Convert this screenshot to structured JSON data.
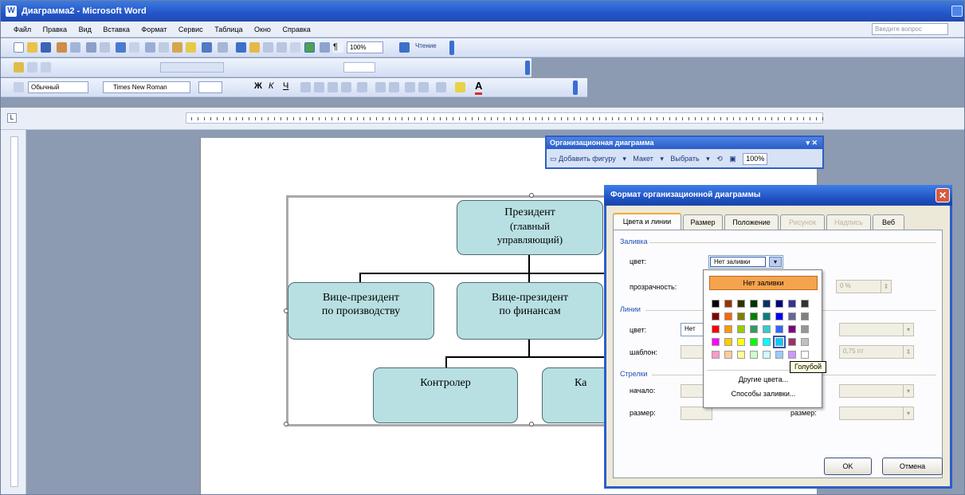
{
  "window": {
    "title": "Диаграмма2 - Microsoft Word"
  },
  "menu": {
    "items": [
      "Файл",
      "Правка",
      "Вид",
      "Вставка",
      "Формат",
      "Сервис",
      "Таблица",
      "Окно",
      "Справка"
    ],
    "ask_placeholder": "Введите вопрос"
  },
  "toolbar_standard": {
    "zoom": "100%",
    "reading_label": "Чтение"
  },
  "toolbar_format": {
    "style": "Обычный",
    "font": "Times New Roman"
  },
  "chart": {
    "president": [
      "Президент",
      "(главный",
      "управляющий)"
    ],
    "vp_production": [
      "Вице-президент",
      "по производству"
    ],
    "vp_finance": [
      "Вице-президент",
      "по финансам"
    ],
    "controller": "Контролер",
    "cashier": "Ка"
  },
  "orgbar": {
    "title": "Организационная диаграмма",
    "add_shape": "Добавить фигуру",
    "layout": "Макет",
    "select": "Выбрать",
    "zoom": "100%"
  },
  "dialog": {
    "title": "Формат организационной диаграммы",
    "tabs": [
      "Цвета и линии",
      "Размер",
      "Положение",
      "Рисунок",
      "Надпись",
      "Веб"
    ],
    "fill_group": "Заливка",
    "color_label": "цвет:",
    "color_value": "Нет заливки",
    "transparency_label": "прозрачность:",
    "transparency_value": "0 %",
    "lines_group": "Линии",
    "line_color_label": "цвет:",
    "line_color_value": "Нет",
    "pattern_label": "шаблон:",
    "thickness_value": "0,75 пт",
    "arrows_group": "Стрелки",
    "begin_label": "начало:",
    "size_label": "размер:",
    "size_label2": "размер:",
    "ok": "OK",
    "cancel": "Отмена"
  },
  "colorpopup": {
    "no_fill": "Нет заливки",
    "more_colors": "Другие цвета...",
    "fill_effects": "Способы заливки...",
    "tooltip": "Голубой",
    "rows": [
      [
        "#000000",
        "#993300",
        "#333300",
        "#003300",
        "#003366",
        "#000080",
        "#333399",
        "#333333"
      ],
      [
        "#800000",
        "#FF6600",
        "#808000",
        "#008000",
        "#008080",
        "#0000FF",
        "#666699",
        "#808080"
      ],
      [
        "#FF0000",
        "#FF9900",
        "#99CC00",
        "#339966",
        "#33CCCC",
        "#3366FF",
        "#800080",
        "#969696"
      ],
      [
        "#FF00FF",
        "#FFCC00",
        "#FFFF00",
        "#00FF00",
        "#00FFFF",
        "#00CCFF",
        "#993366",
        "#C0C0C0"
      ],
      [
        "#FF99CC",
        "#FFCC99",
        "#FFFF99",
        "#CCFFCC",
        "#CCFFFF",
        "#99CCFF",
        "#CC99FF",
        "#FFFFFF"
      ]
    ]
  }
}
